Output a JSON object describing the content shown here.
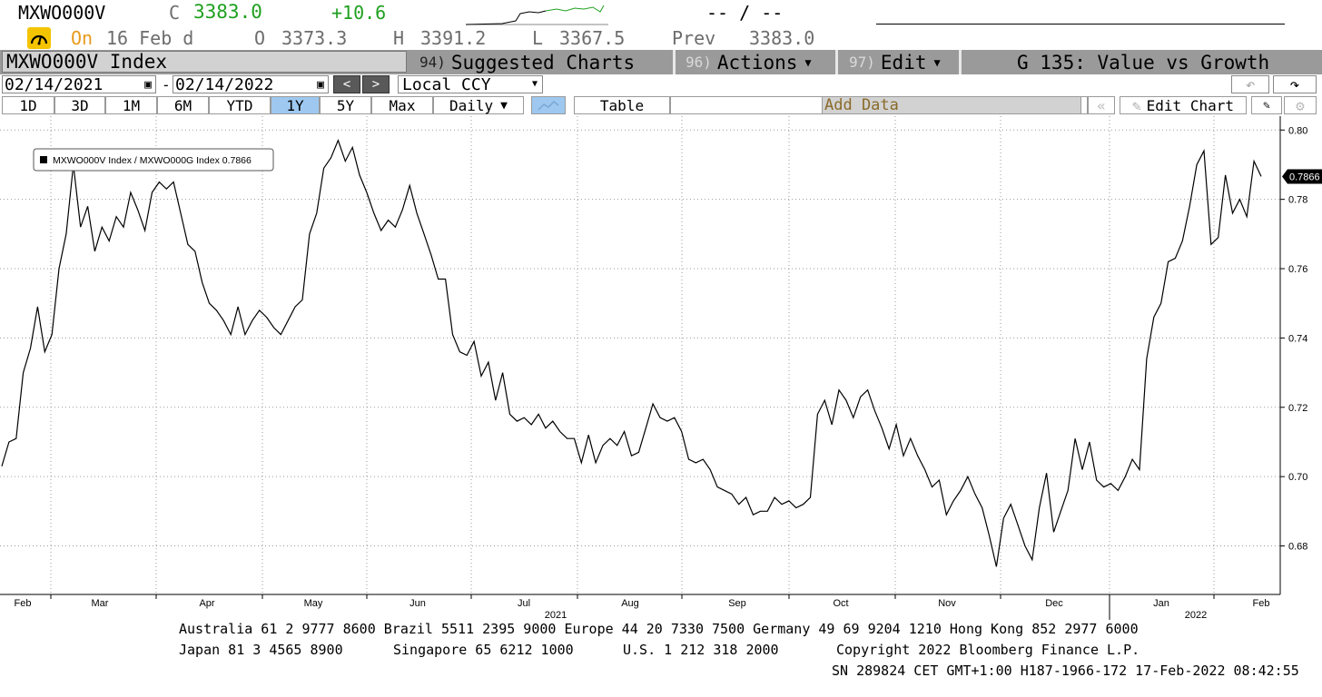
{
  "quote": {
    "ticker": "MXWO000V",
    "close_label": "C",
    "close_value": "3383.0",
    "change": "+10.6",
    "bidask": "-- / --",
    "status": "On",
    "date": "16 Feb d",
    "open_label": "O",
    "open_value": "3373.3",
    "high_label": "H",
    "high_value": "3391.2",
    "low_label": "L",
    "low_value": "3367.5",
    "prev_label": "Prev",
    "prev_value": "3383.0"
  },
  "titlebar": {
    "security": "MXWO000V Index",
    "suggested_num": "94)",
    "suggested_label": "Suggested Charts",
    "actions_num": "96)",
    "actions_label": "Actions",
    "edit_num": "97)",
    "edit_label": "Edit",
    "function_title": "G 135: Value vs Growth"
  },
  "controls": {
    "start_date": "02/14/2021",
    "end_date": "02/14/2022",
    "currency": "Local CCY",
    "periods": [
      "1D",
      "3D",
      "1M",
      "6M",
      "YTD",
      "1Y",
      "5Y",
      "Max"
    ],
    "active_period": "1Y",
    "frequency": "Daily",
    "table_label": "Table",
    "add_data_label": "Add Data",
    "edit_chart_label": "Edit Chart"
  },
  "colors": {
    "line": "#000000",
    "active_tab": "#9ec8ef",
    "up": "#1fa01f",
    "status": "#e89a1c"
  },
  "chart_data": {
    "type": "line",
    "legend": "MXWO000V Index / MXWO000G Index 0.7866",
    "last_value_label": "0.7866",
    "ylim": [
      0.666,
      0.804
    ],
    "yticks": [
      "0.80",
      "0.78",
      "0.76",
      "0.74",
      "0.72",
      "0.70",
      "0.68"
    ],
    "months": [
      "Feb",
      "Mar",
      "Apr",
      "May",
      "Jun",
      "Jul",
      "Aug",
      "Sep",
      "Oct",
      "Nov",
      "Dec",
      "Jan",
      "Feb"
    ],
    "year_labels": [
      "2021",
      "2022"
    ],
    "grid": true,
    "series": [
      {
        "values": [
          0.703,
          0.71,
          0.711,
          0.73,
          0.737,
          0.749,
          0.736,
          0.741,
          0.76,
          0.77,
          0.79,
          0.772,
          0.778,
          0.765,
          0.772,
          0.768,
          0.775,
          0.772,
          0.782,
          0.777,
          0.771,
          0.782,
          0.785,
          0.783,
          0.785,
          0.776,
          0.767,
          0.765,
          0.756,
          0.75,
          0.748,
          0.745,
          0.741,
          0.749,
          0.741,
          0.745,
          0.748,
          0.746,
          0.743,
          0.741,
          0.745,
          0.749,
          0.751,
          0.77,
          0.776,
          0.789,
          0.792,
          0.797,
          0.791,
          0.795,
          0.787,
          0.782,
          0.776,
          0.771,
          0.774,
          0.772,
          0.777,
          0.784,
          0.776,
          0.77,
          0.764,
          0.757,
          0.757,
          0.741,
          0.736,
          0.735,
          0.739,
          0.729,
          0.733,
          0.722,
          0.73,
          0.718,
          0.716,
          0.717,
          0.715,
          0.718,
          0.714,
          0.716,
          0.713,
          0.711,
          0.711,
          0.704,
          0.712,
          0.704,
          0.709,
          0.711,
          0.709,
          0.713,
          0.706,
          0.707,
          0.714,
          0.721,
          0.717,
          0.716,
          0.717,
          0.713,
          0.705,
          0.704,
          0.705,
          0.702,
          0.697,
          0.696,
          0.695,
          0.692,
          0.694,
          0.689,
          0.69,
          0.69,
          0.694,
          0.692,
          0.693,
          0.691,
          0.692,
          0.694,
          0.718,
          0.722,
          0.715,
          0.725,
          0.722,
          0.717,
          0.723,
          0.725,
          0.719,
          0.714,
          0.708,
          0.715,
          0.706,
          0.711,
          0.706,
          0.702,
          0.697,
          0.699,
          0.689,
          0.693,
          0.696,
          0.7,
          0.695,
          0.691,
          0.683,
          0.674,
          0.688,
          0.692,
          0.686,
          0.68,
          0.676,
          0.691,
          0.701,
          0.684,
          0.69,
          0.696,
          0.711,
          0.702,
          0.71,
          0.699,
          0.697,
          0.698,
          0.696,
          0.7,
          0.705,
          0.702,
          0.734,
          0.746,
          0.75,
          0.762,
          0.763,
          0.768,
          0.778,
          0.79,
          0.794,
          0.767,
          0.769,
          0.787,
          0.776,
          0.78,
          0.775,
          0.791,
          0.7866
        ]
      }
    ]
  },
  "footer": {
    "line1": "Australia 61 2 9777 8600 Brazil 5511 2395 9000 Europe 44 20 7330 7500 Germany 49 69 9204 1210 Hong Kong 852 2977 6000",
    "line2a": "Japan 81 3 4565 8900",
    "line2b": "Singapore 65 6212 1000",
    "line2c": "U.S. 1 212 318 2000",
    "line2d": "Copyright 2022 Bloomberg Finance L.P.",
    "line3": "SN 289824 CET  GMT+1:00 H187-1966-172 17-Feb-2022 08:42:55"
  }
}
